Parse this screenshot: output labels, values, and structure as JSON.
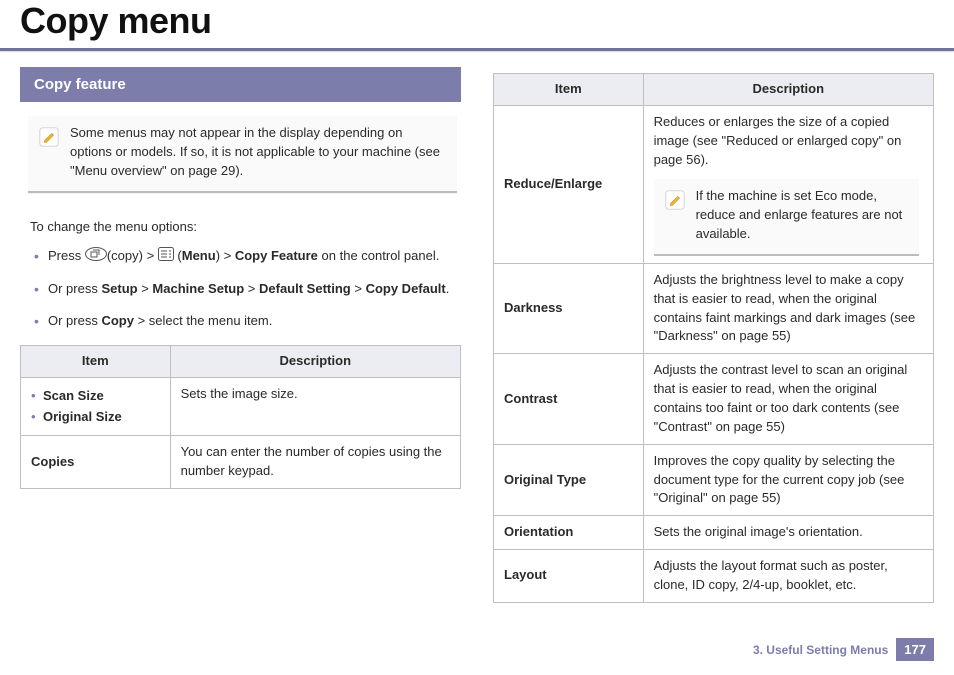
{
  "page_title": "Copy menu",
  "section_header": "Copy feature",
  "note1": "Some menus may not appear in the display depending on options or models. If so, it is not applicable to your machine (see \"Menu overview\" on page 29).",
  "intro": "To change the menu options:",
  "step1_press": "Press ",
  "step1_copy_label": "(copy) > ",
  "step1_paren_open": " (",
  "step1_menu": "Menu",
  "step1_paren_close": ") > ",
  "step1_copy_feature": "Copy Feature",
  "step1_tail": " on the control panel.",
  "step2_a": "Or press ",
  "step2_b": "Setup",
  "step2_c": " > ",
  "step2_d": "Machine Setup",
  "step2_e": " > ",
  "step2_f": "Default Setting",
  "step2_g": " > ",
  "step2_h": "Copy Default",
  "step2_i": ".",
  "step3_a": "Or press ",
  "step3_b": "Copy",
  "step3_c": " > select the menu item.",
  "table_header_item": "Item",
  "table_header_desc": "Description",
  "left_table": [
    {
      "item_multi_a": "Scan Size",
      "item_multi_b": "Original Size",
      "desc": "Sets the image size."
    },
    {
      "item": "Copies",
      "desc": "You can enter the number of copies using the number keypad."
    }
  ],
  "right_table": [
    {
      "item": "Reduce/Enlarge",
      "desc": "Reduces or enlarges the size of a copied image (see \"Reduced or enlarged copy\" on page 56).",
      "note": "If the machine is set Eco mode, reduce and enlarge features are not available."
    },
    {
      "item": "Darkness",
      "desc": "Adjusts the brightness level to make a copy that is easier to read, when the original contains faint markings and dark images (see \"Darkness\" on page 55)"
    },
    {
      "item": "Contrast",
      "desc": "Adjusts the contrast level to scan an original that is easier to read, when the original contains too faint or too dark contents (see \"Contrast\" on page 55)"
    },
    {
      "item": "Original Type",
      "desc": "Improves the copy quality by selecting the document type for the current copy job (see \"Original\" on page 55)"
    },
    {
      "item": "Orientation",
      "desc": "Sets the original image's orientation."
    },
    {
      "item": "Layout",
      "desc": "Adjusts the layout format such as poster, clone, ID copy, 2/4-up, booklet, etc."
    }
  ],
  "footer_chapter": "3.  Useful Setting Menus",
  "footer_page": "177"
}
